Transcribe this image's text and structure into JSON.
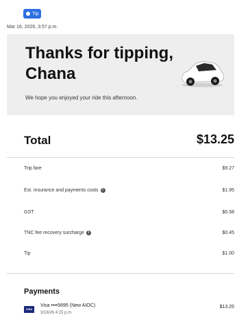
{
  "badge": {
    "label": "Tip"
  },
  "timestamp": "Mar 16, 2026, 3:57 p.m.",
  "hero": {
    "title": "Thanks for tipping, Chana",
    "subtitle": "We hope you enjoyed your ride this afternoon."
  },
  "total": {
    "label": "Total",
    "value": "$13.25"
  },
  "items": [
    {
      "label": "Trip fare",
      "value": "$9.27",
      "info": false
    },
    {
      "label": "Est. insurance and payments costs",
      "value": "$1.95",
      "info": true
    },
    {
      "label": "GST",
      "value": "$0.58",
      "info": false
    },
    {
      "label": "TNC fee recovery surcharge",
      "value": "$0.45",
      "info": true
    },
    {
      "label": "Tip",
      "value": "$1.00",
      "info": false
    }
  ],
  "payments": {
    "title": "Payments",
    "card": "Visa ••••5695 (New AIOC)",
    "date": "3/16/26 4:15 p.m.",
    "amount": "$13.25",
    "logo_text": "VISA"
  },
  "colors": {
    "badge": "#2d6fe0",
    "hero_bg": "#eeeeee",
    "visa": "#1a2a7a"
  }
}
